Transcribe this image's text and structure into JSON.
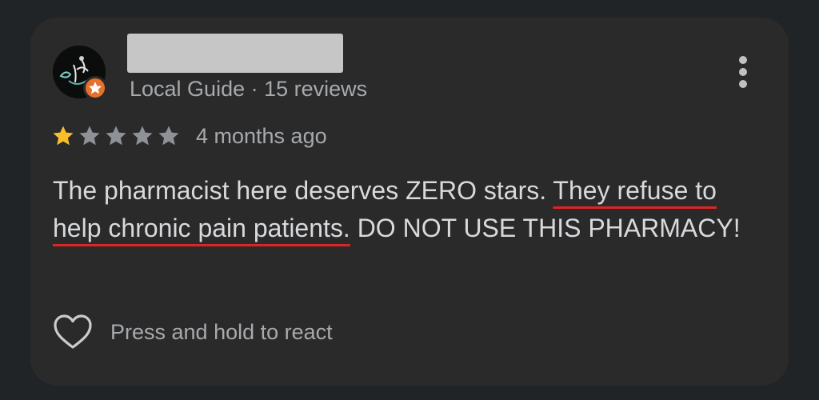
{
  "review": {
    "reviewer": {
      "name": "",
      "name_redacted": true,
      "avatar_icon": "avatar-image",
      "badge_icon": "local-guide-badge-icon",
      "badge_color": "#e8702a",
      "subtitle": "Local Guide · 15 reviews"
    },
    "rating": {
      "value": 1,
      "max": 5,
      "filled_color": "#f9bf2a",
      "empty_color": "#8e9196"
    },
    "time_ago": "4 months ago",
    "text_parts": [
      {
        "text": "The pharmacist here deserves ZERO stars. ",
        "underlined": false
      },
      {
        "text": "They refuse to help chronic pain patients.",
        "underlined": true
      },
      {
        "text": " DO NOT USE THIS PHARMACY!",
        "underlined": false
      }
    ],
    "underline_color": "#e02424",
    "more_menu_icon": "more-vert-icon",
    "react": {
      "icon": "heart-outline-icon",
      "label": "Press and hold to react"
    }
  }
}
